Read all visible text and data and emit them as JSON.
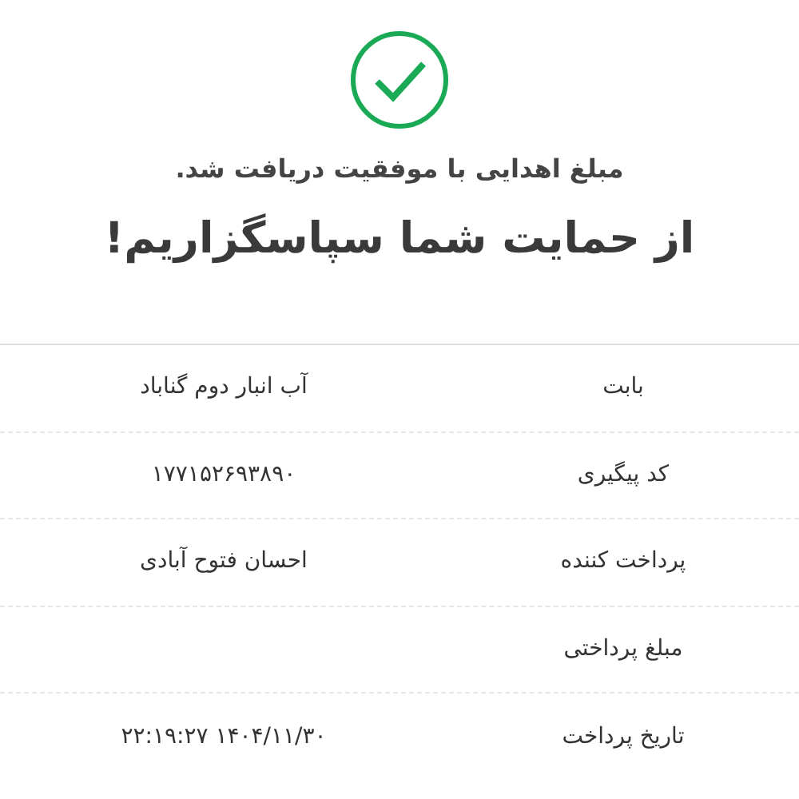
{
  "status": {
    "kind": "success"
  },
  "message": "مبلغ اهدایی با موفقیت دریافت شد.",
  "title": "از حمایت شما سپاسگزاریم!",
  "details": [
    {
      "label": "بابت",
      "value": "آب انبار دوم گناباد"
    },
    {
      "label": "کد پیگیری",
      "value": "۱۷۷۱۵۲۶۹۳۸۹۰"
    },
    {
      "label": "پرداخت کننده",
      "value": "احسان فتوح آبادی"
    },
    {
      "label": "مبلغ پرداختی"
    },
    {
      "label": "تاریخ پرداخت",
      "value": "۱۴۰۴/۱۱/۳۰ ۲۲:۱۹:۲۷"
    }
  ]
}
